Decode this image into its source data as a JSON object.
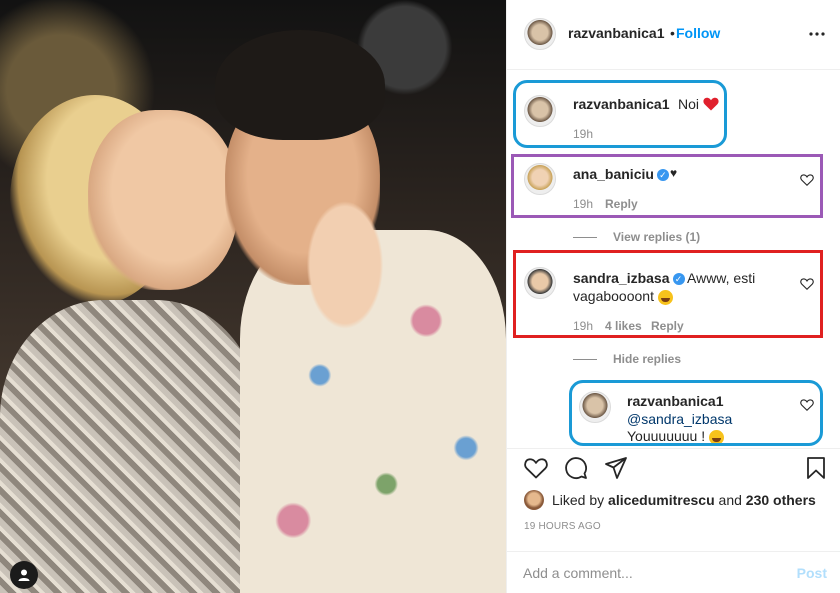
{
  "header": {
    "username": "razvanbanica1",
    "separator": "•",
    "follow_label": "Follow",
    "more_icon": "more-options-icon"
  },
  "caption": {
    "username": "razvanbanica1",
    "text": "Noi",
    "time": "19h"
  },
  "comments": [
    {
      "username": "ana_baniciu",
      "verified": true,
      "text": "♥",
      "time": "19h",
      "reply_label": "Reply",
      "view_replies": "View replies (1)"
    },
    {
      "username": "sandra_izbasa",
      "verified": true,
      "text_line1": "Awww, esti",
      "text_line2": "vagaboooont",
      "time": "19h",
      "likes": "4 likes",
      "reply_label": "Reply",
      "hide_replies": "Hide replies"
    }
  ],
  "reply": {
    "username": "razvanbanica1",
    "mention": "@sandra_izbasa",
    "text": "Youuuuuuu !"
  },
  "likes_line": {
    "prefix": "Liked by",
    "user": "alicedumitrescu",
    "and": "and",
    "others": "230 others"
  },
  "timestamp": "19 HOURS AGO",
  "add_comment": {
    "placeholder": "Add a comment...",
    "post_label": "Post"
  },
  "colors": {
    "accent": "#0095f6",
    "like_red": "#ed4956",
    "annotation_blue": "#1a9ad6",
    "annotation_purple": "#9b59b6",
    "annotation_red": "#e02020"
  }
}
